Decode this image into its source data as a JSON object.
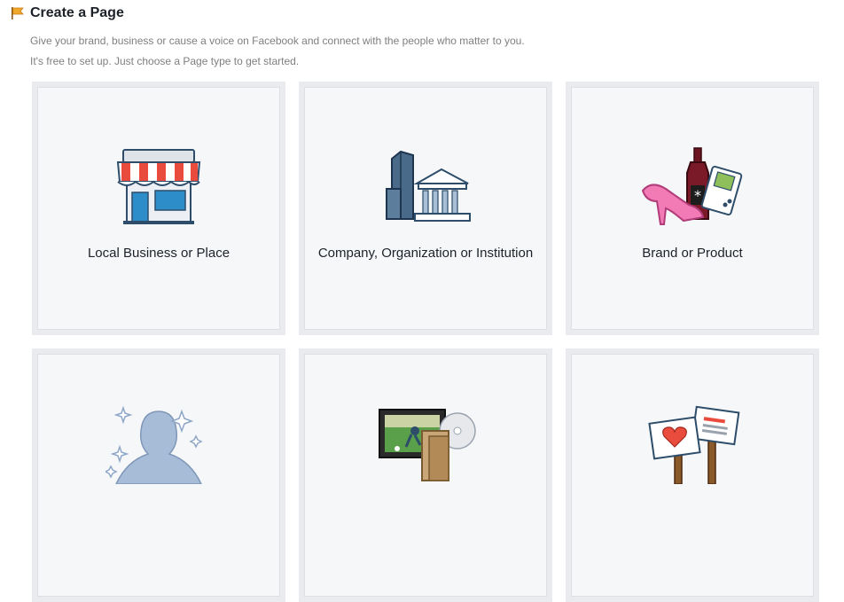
{
  "header": {
    "title": "Create a Page",
    "description_line1": "Give your brand, business or cause a voice on Facebook and connect with the people who matter to you.",
    "description_line2": "It's free to set up. Just choose a Page type to get started."
  },
  "tiles": [
    {
      "label": "Local Business or Place",
      "icon": "storefront-icon"
    },
    {
      "label": "Company, Organization or Institution",
      "icon": "company-building-icon"
    },
    {
      "label": "Brand or Product",
      "icon": "products-icon"
    },
    {
      "label": "",
      "icon": "public-figure-silhouette-icon"
    },
    {
      "label": "",
      "icon": "entertainment-tv-icon"
    },
    {
      "label": "",
      "icon": "cause-signs-icon"
    }
  ],
  "colors": {
    "tile_border": "#e9ebee",
    "tile_background": "#f6f7f9",
    "awning_red": "#e94b3c",
    "awning_stripe": "#ffffff",
    "outline_navy": "#2d4d6a"
  }
}
